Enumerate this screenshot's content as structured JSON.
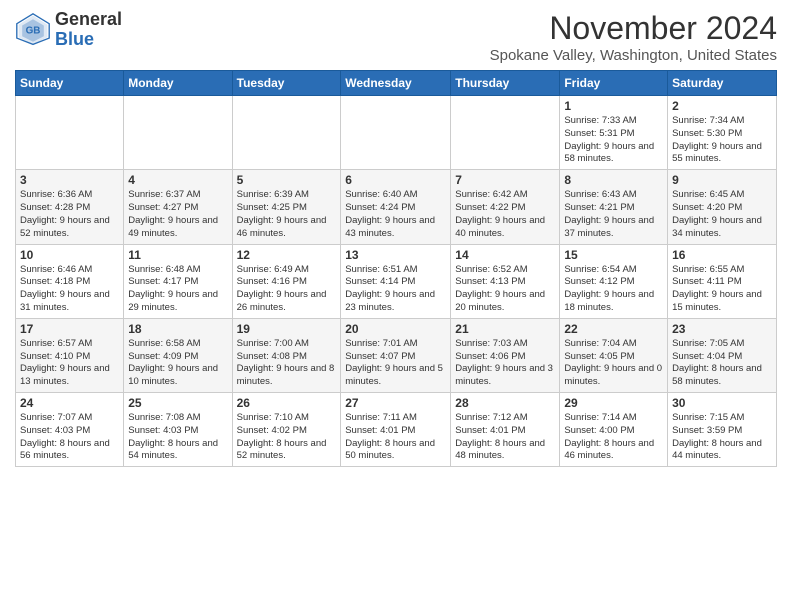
{
  "header": {
    "logo_general": "General",
    "logo_blue": "Blue",
    "month_title": "November 2024",
    "location": "Spokane Valley, Washington, United States"
  },
  "weekdays": [
    "Sunday",
    "Monday",
    "Tuesday",
    "Wednesday",
    "Thursday",
    "Friday",
    "Saturday"
  ],
  "weeks": [
    [
      {
        "day": "",
        "info": ""
      },
      {
        "day": "",
        "info": ""
      },
      {
        "day": "",
        "info": ""
      },
      {
        "day": "",
        "info": ""
      },
      {
        "day": "",
        "info": ""
      },
      {
        "day": "1",
        "info": "Sunrise: 7:33 AM\nSunset: 5:31 PM\nDaylight: 9 hours\nand 58 minutes."
      },
      {
        "day": "2",
        "info": "Sunrise: 7:34 AM\nSunset: 5:30 PM\nDaylight: 9 hours\nand 55 minutes."
      }
    ],
    [
      {
        "day": "3",
        "info": "Sunrise: 6:36 AM\nSunset: 4:28 PM\nDaylight: 9 hours\nand 52 minutes."
      },
      {
        "day": "4",
        "info": "Sunrise: 6:37 AM\nSunset: 4:27 PM\nDaylight: 9 hours\nand 49 minutes."
      },
      {
        "day": "5",
        "info": "Sunrise: 6:39 AM\nSunset: 4:25 PM\nDaylight: 9 hours\nand 46 minutes."
      },
      {
        "day": "6",
        "info": "Sunrise: 6:40 AM\nSunset: 4:24 PM\nDaylight: 9 hours\nand 43 minutes."
      },
      {
        "day": "7",
        "info": "Sunrise: 6:42 AM\nSunset: 4:22 PM\nDaylight: 9 hours\nand 40 minutes."
      },
      {
        "day": "8",
        "info": "Sunrise: 6:43 AM\nSunset: 4:21 PM\nDaylight: 9 hours\nand 37 minutes."
      },
      {
        "day": "9",
        "info": "Sunrise: 6:45 AM\nSunset: 4:20 PM\nDaylight: 9 hours\nand 34 minutes."
      }
    ],
    [
      {
        "day": "10",
        "info": "Sunrise: 6:46 AM\nSunset: 4:18 PM\nDaylight: 9 hours\nand 31 minutes."
      },
      {
        "day": "11",
        "info": "Sunrise: 6:48 AM\nSunset: 4:17 PM\nDaylight: 9 hours\nand 29 minutes."
      },
      {
        "day": "12",
        "info": "Sunrise: 6:49 AM\nSunset: 4:16 PM\nDaylight: 9 hours\nand 26 minutes."
      },
      {
        "day": "13",
        "info": "Sunrise: 6:51 AM\nSunset: 4:14 PM\nDaylight: 9 hours\nand 23 minutes."
      },
      {
        "day": "14",
        "info": "Sunrise: 6:52 AM\nSunset: 4:13 PM\nDaylight: 9 hours\nand 20 minutes."
      },
      {
        "day": "15",
        "info": "Sunrise: 6:54 AM\nSunset: 4:12 PM\nDaylight: 9 hours\nand 18 minutes."
      },
      {
        "day": "16",
        "info": "Sunrise: 6:55 AM\nSunset: 4:11 PM\nDaylight: 9 hours\nand 15 minutes."
      }
    ],
    [
      {
        "day": "17",
        "info": "Sunrise: 6:57 AM\nSunset: 4:10 PM\nDaylight: 9 hours\nand 13 minutes."
      },
      {
        "day": "18",
        "info": "Sunrise: 6:58 AM\nSunset: 4:09 PM\nDaylight: 9 hours\nand 10 minutes."
      },
      {
        "day": "19",
        "info": "Sunrise: 7:00 AM\nSunset: 4:08 PM\nDaylight: 9 hours\nand 8 minutes."
      },
      {
        "day": "20",
        "info": "Sunrise: 7:01 AM\nSunset: 4:07 PM\nDaylight: 9 hours\nand 5 minutes."
      },
      {
        "day": "21",
        "info": "Sunrise: 7:03 AM\nSunset: 4:06 PM\nDaylight: 9 hours\nand 3 minutes."
      },
      {
        "day": "22",
        "info": "Sunrise: 7:04 AM\nSunset: 4:05 PM\nDaylight: 9 hours\nand 0 minutes."
      },
      {
        "day": "23",
        "info": "Sunrise: 7:05 AM\nSunset: 4:04 PM\nDaylight: 8 hours\nand 58 minutes."
      }
    ],
    [
      {
        "day": "24",
        "info": "Sunrise: 7:07 AM\nSunset: 4:03 PM\nDaylight: 8 hours\nand 56 minutes."
      },
      {
        "day": "25",
        "info": "Sunrise: 7:08 AM\nSunset: 4:03 PM\nDaylight: 8 hours\nand 54 minutes."
      },
      {
        "day": "26",
        "info": "Sunrise: 7:10 AM\nSunset: 4:02 PM\nDaylight: 8 hours\nand 52 minutes."
      },
      {
        "day": "27",
        "info": "Sunrise: 7:11 AM\nSunset: 4:01 PM\nDaylight: 8 hours\nand 50 minutes."
      },
      {
        "day": "28",
        "info": "Sunrise: 7:12 AM\nSunset: 4:01 PM\nDaylight: 8 hours\nand 48 minutes."
      },
      {
        "day": "29",
        "info": "Sunrise: 7:14 AM\nSunset: 4:00 PM\nDaylight: 8 hours\nand 46 minutes."
      },
      {
        "day": "30",
        "info": "Sunrise: 7:15 AM\nSunset: 3:59 PM\nDaylight: 8 hours\nand 44 minutes."
      }
    ]
  ]
}
